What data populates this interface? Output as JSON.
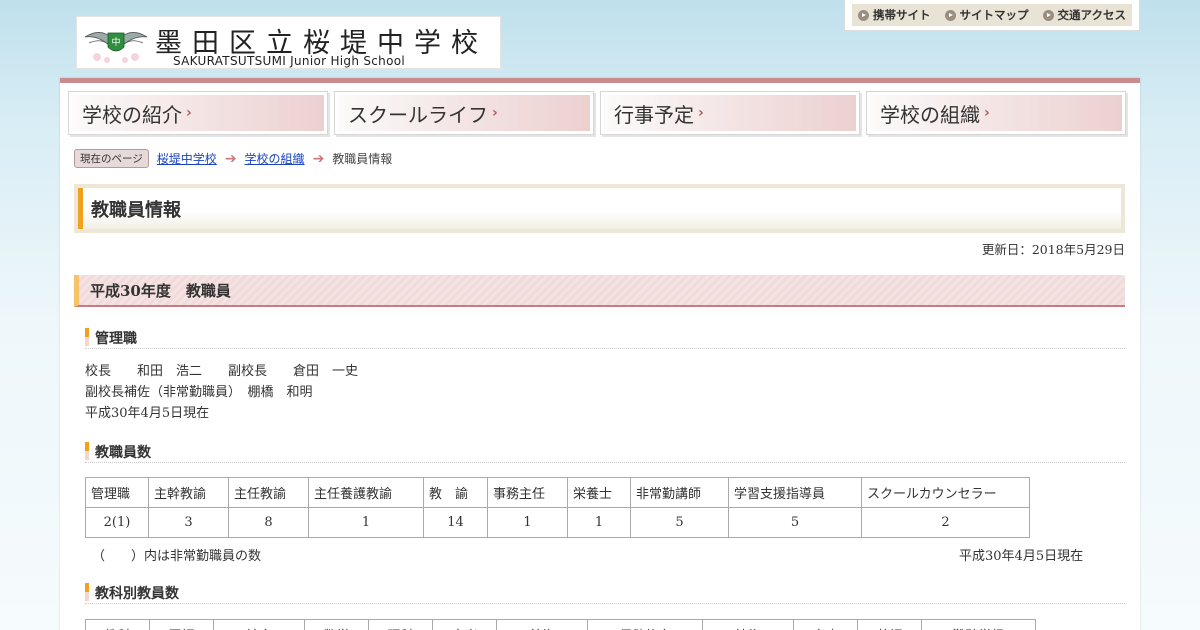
{
  "header": {
    "school_name": "墨田区立桜堤中学校",
    "school_name_en": "SAKURATSUTSUMI  Junior High School",
    "util_links": [
      "携帯サイト",
      "サイトマップ",
      "交通アクセス"
    ]
  },
  "gnav": [
    "学校の紹介",
    "スクールライフ",
    "行事予定",
    "学校の組織"
  ],
  "breadcrumb": {
    "badge": "現在のページ",
    "links": [
      "桜堤中学校",
      "学校の組織"
    ],
    "current": "教職員情報"
  },
  "page": {
    "title": "教職員情報",
    "updated": "更新日：2018年5月29日",
    "h2": "平成30年度　教職員",
    "management": {
      "heading": "管理職",
      "lines": [
        "校長　　和田　浩二　　副校長　　倉田　一史",
        "副校長補佐（非常勤職員）　棚橋　和明",
        "平成30年4月5日現在"
      ]
    },
    "staff_count": {
      "heading": "教職員数",
      "headers": [
        "管理職",
        "主幹教諭",
        "主任教諭",
        "主任養護教諭",
        "教　諭",
        "事務主任",
        "栄養士",
        "非常勤講師",
        "学習支援指導員",
        "スクールカウンセラー"
      ],
      "values": [
        "2(1)",
        "3",
        "8",
        "1",
        "14",
        "1",
        "1",
        "5",
        "5",
        "2"
      ],
      "note": "（　　）内は非常勤職員の数",
      "date": "平成30年4月5日現在"
    },
    "subject_count": {
      "heading": "教科別教員数",
      "headers": [
        "教科",
        "国語",
        "社会",
        "数学",
        "理科",
        "音楽",
        "美術",
        "保健体育",
        "技術",
        "家庭",
        "英語",
        "難聴学級"
      ]
    }
  }
}
